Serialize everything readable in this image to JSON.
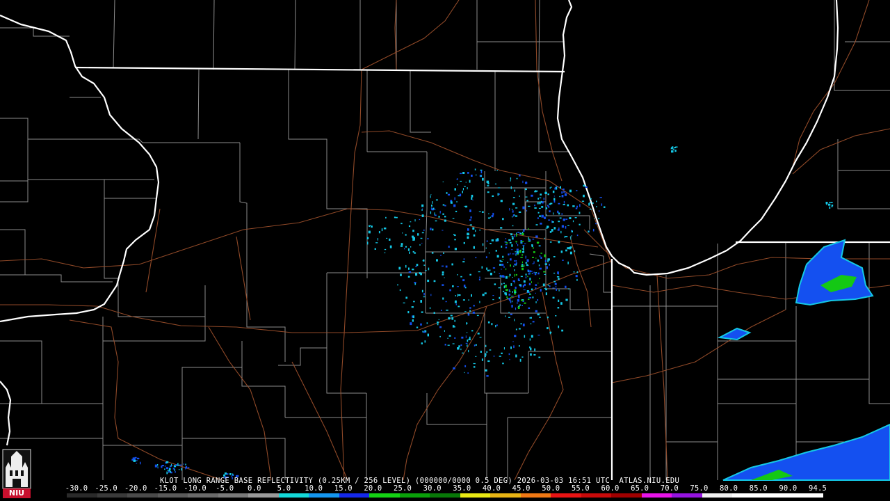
{
  "product": {
    "radar_site": "KLOT",
    "caption": "KLOT LONG RANGE BASE REFLECTIVITY (0.25KM / 256 LEVEL) (000000/0000 0.5 DEG) 2026-03-03 16:51 UTC  ATLAS.NIU.EDU"
  },
  "logo": {
    "text": "NIU"
  },
  "colorbar": {
    "labels": [
      "-30.0",
      "-25.0",
      "-20.0",
      "-15.0",
      "-10.0",
      "-5.0",
      "0.0",
      "5.0",
      "10.0",
      "15.0",
      "20.0",
      "25.0",
      "30.0",
      "35.0",
      "40.0",
      "45.0",
      "50.0",
      "55.0",
      "60.0",
      "65.0",
      "70.0",
      "75.0",
      "80.0",
      "85.0",
      "90.0",
      "94.5"
    ],
    "colors": [
      "#2a2a2a",
      "#3a3a3a",
      "#4a4a4a",
      "#5a5a5a",
      "#6a6a6a",
      "#7a7a7a",
      "#9a9a9a",
      "#14d8d8",
      "#1496f0",
      "#1428e8",
      "#14d214",
      "#0aa00a",
      "#087808",
      "#e8e814",
      "#e8b414",
      "#f07814",
      "#e81414",
      "#c80a0a",
      "#a00000",
      "#e814e8",
      "#9614e0",
      "#f0f0f0",
      "#ffffff",
      "#ffffff",
      "#ffffff"
    ],
    "accent_colors": {
      "border": "#ffffff",
      "roads": "#a0522d",
      "counties": "#8c8c8c",
      "echo_light": "#14c8e6",
      "echo_mid": "#1450f0",
      "echo_strong": "#14c814"
    }
  }
}
